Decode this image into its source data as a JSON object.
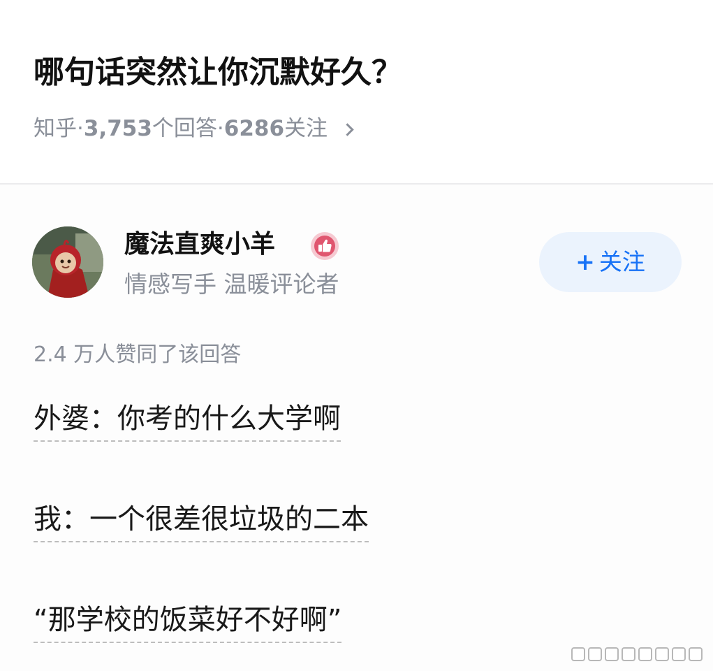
{
  "question": {
    "title": "哪句话突然让你沉默好久？",
    "source": "知乎",
    "separator": "·",
    "answer_count": "3,753",
    "answer_unit": " 个回答",
    "follow_count": "6286",
    "follow_unit": " 关注"
  },
  "author": {
    "name": "魔法直爽小羊",
    "tags": "情感写手 温暖评论者",
    "badge_icon": "thumbs-up-badge-icon",
    "badge_color": "#e0566f"
  },
  "follow_button": {
    "plus": "+",
    "label": "关注",
    "color": "#1772f6",
    "background": "#ebf3fd"
  },
  "answer": {
    "upvote_summary": "2.4 万人赞同了该回答",
    "lines": [
      "外婆：你考的什么大学啊",
      "我：一个很差很垃圾的二本",
      "“那学校的饭菜好不好啊”"
    ]
  }
}
